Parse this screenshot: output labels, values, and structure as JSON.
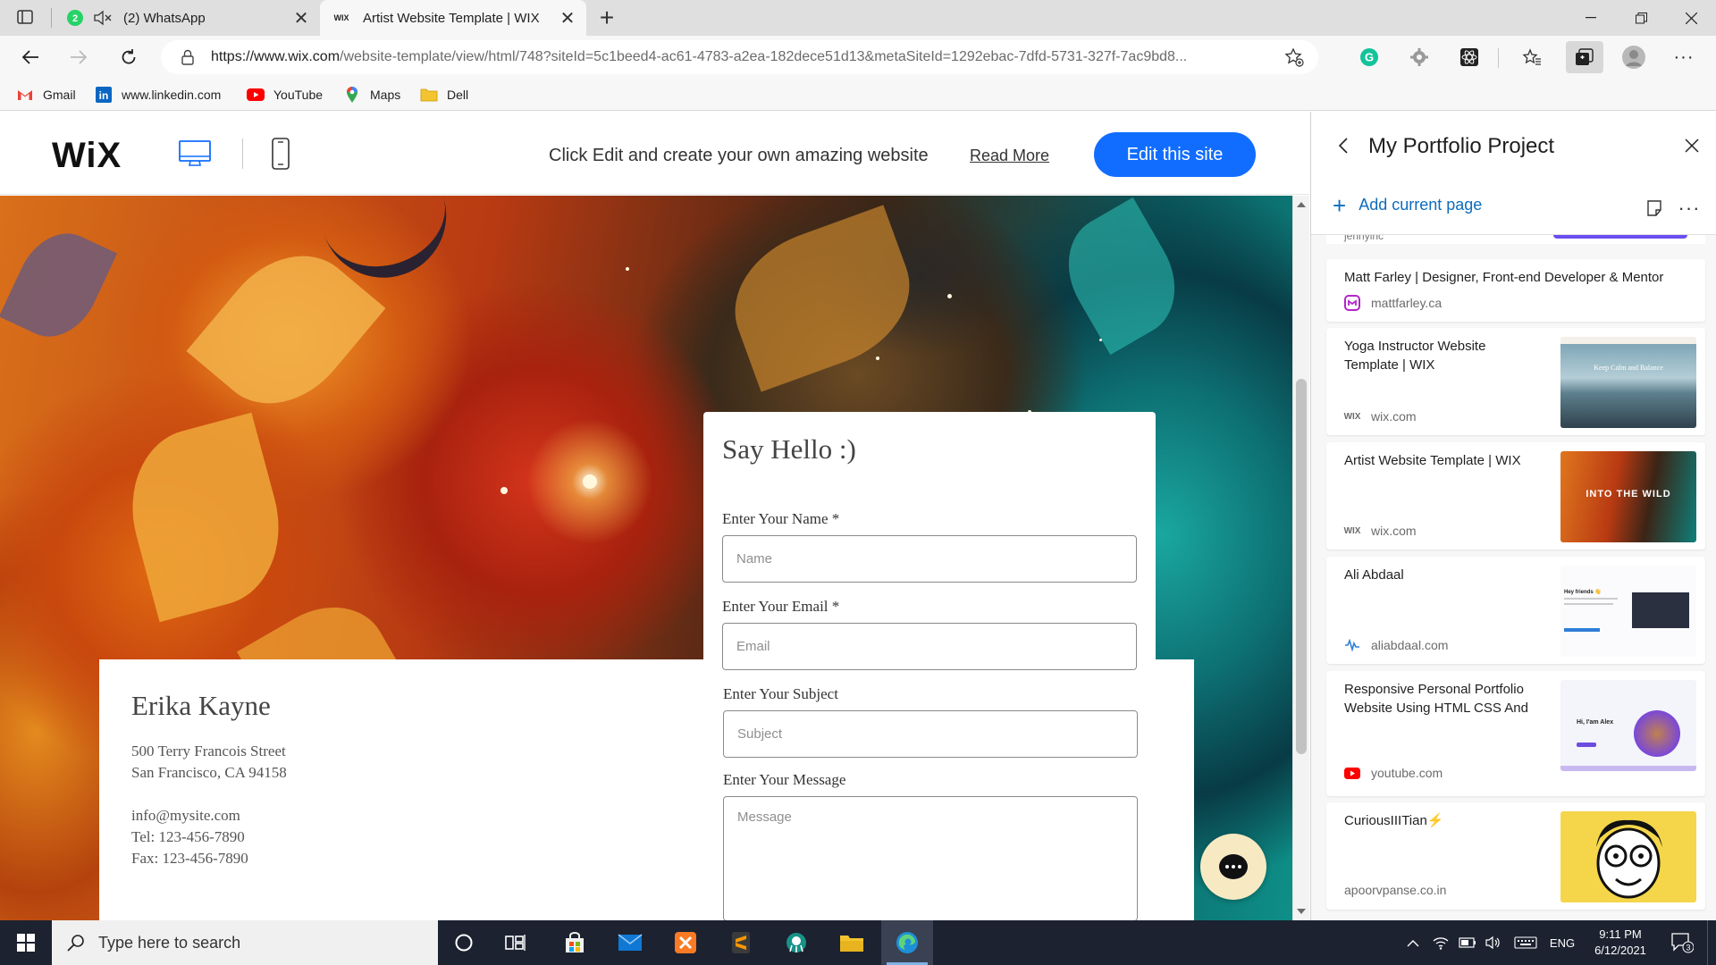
{
  "browser": {
    "tabs": [
      {
        "title": "(2) WhatsApp",
        "badge": "2"
      },
      {
        "title": "Artist Website Template | WIX",
        "favicon": "WIX"
      }
    ],
    "address": {
      "host": "https://www.wix.com",
      "path": "/website-template/view/html/748?siteId=5c1beed4-ac61-4783-a2ea-182dece51d13&metaSiteId=1292ebac-7dfd-5731-327f-7ac9bd8..."
    },
    "bookmarks": [
      "Gmail",
      "www.linkedin.com",
      "YouTube",
      "Maps",
      "Dell"
    ]
  },
  "wix_header": {
    "logo": "WiX",
    "promo_text": "Click Edit and create your own amazing website",
    "read_more": "Read More",
    "edit_button": "Edit this site"
  },
  "site": {
    "name": "Erika Kayne",
    "address_line1": "500 Terry Francois Street",
    "address_line2": "San Francisco, CA 94158",
    "email": "info@mysite.com",
    "tel": "Tel: 123-456-7890",
    "fax": "Fax: 123-456-7890",
    "form": {
      "heading": "Say Hello :)",
      "name_label": "Enter Your Name *",
      "name_placeholder": "Name",
      "email_label": "Enter Your Email *",
      "email_placeholder": "Email",
      "subject_label": "Enter Your Subject",
      "subject_placeholder": "Subject",
      "message_label": "Enter Your Message",
      "message_placeholder": "Message"
    }
  },
  "collections": {
    "title": "My Portfolio Project",
    "add_current_page": "Add current page",
    "partial_source": "jennyinc",
    "items": [
      {
        "title": "Matt Farley | Designer, Front-end Developer & Mentor",
        "source": "mattfarley.ca",
        "icon": "mattfarley-icon"
      },
      {
        "title_line1": "Yoga Instructor Website",
        "title_line2": "Template | WIX",
        "source": "wix.com",
        "thumb_text": "Keep Calm and Balance"
      },
      {
        "title_line1": "Artist Website Template | WIX",
        "title_line2": "",
        "source": "wix.com",
        "thumb_text": "INTO THE WILD"
      },
      {
        "title_line1": "Ali Abdaal",
        "title_line2": "",
        "source": "aliabdaal.com",
        "thumb_text": "Hey friends 👋"
      },
      {
        "title_line1": "Responsive Personal Portfolio",
        "title_line2": "Website Using HTML CSS And",
        "source": "youtube.com",
        "thumb_text": "Hi, I'am Alex"
      },
      {
        "title_line1": "CuriousIIITian⚡",
        "title_line2": "",
        "source": "apoorvpanse.co.in",
        "thumb_text": ""
      }
    ]
  },
  "taskbar": {
    "search_placeholder": "Type here to search",
    "lang": "ENG",
    "time": "9:11 PM",
    "date": "6/12/2021",
    "notifications": "3"
  },
  "colors": {
    "wix_blue": "#116dff",
    "edge_accent": "#0f6cbd",
    "taskbar": "#1c2230"
  }
}
